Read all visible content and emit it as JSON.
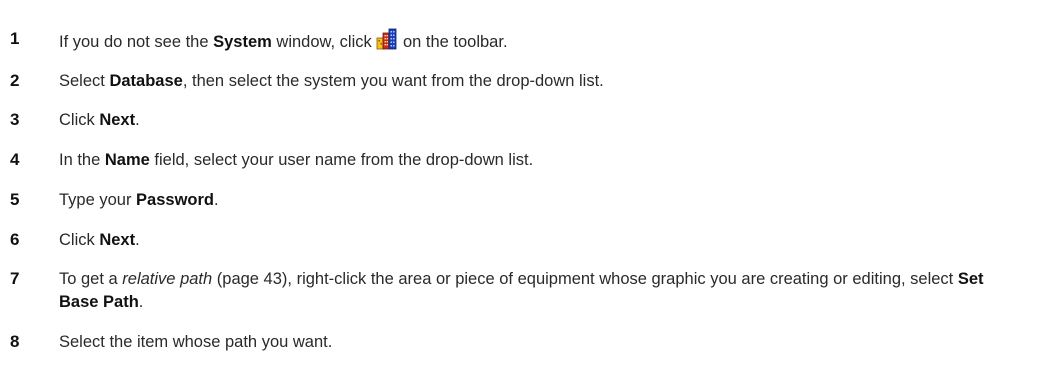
{
  "steps": [
    {
      "number": "1",
      "parts": {
        "a": "If you do not see the ",
        "b": "System",
        "c": " window, click ",
        "d": " on the toolbar."
      },
      "icon": "system-toolbar-icon"
    },
    {
      "number": "2",
      "parts": {
        "a": "Select ",
        "b": "Database",
        "c": ", then select the system you want from the drop-down list."
      }
    },
    {
      "number": "3",
      "parts": {
        "a": "Click ",
        "b": "Next",
        "c": "."
      }
    },
    {
      "number": "4",
      "parts": {
        "a": "In the ",
        "b": "Name",
        "c": " field, select your user name from the drop-down list."
      }
    },
    {
      "number": "5",
      "parts": {
        "a": "Type your ",
        "b": "Password",
        "c": "."
      }
    },
    {
      "number": "6",
      "parts": {
        "a": "Click ",
        "b": "Next",
        "c": "."
      }
    },
    {
      "number": "7",
      "parts": {
        "a": "To get a ",
        "b": "relative path",
        "c": " (page 43), right-click the area or piece of equipment whose graphic you are creating or editing, select ",
        "d": "Set Base Path",
        "e": "."
      }
    },
    {
      "number": "8",
      "parts": {
        "a": "Select the item whose path you want."
      }
    }
  ],
  "colors": {
    "text": "#2a2a2a",
    "bold": "#111111",
    "icon_red": "#cc2a1a",
    "icon_blue": "#1f3fb8",
    "icon_yellow": "#f4c21a"
  }
}
